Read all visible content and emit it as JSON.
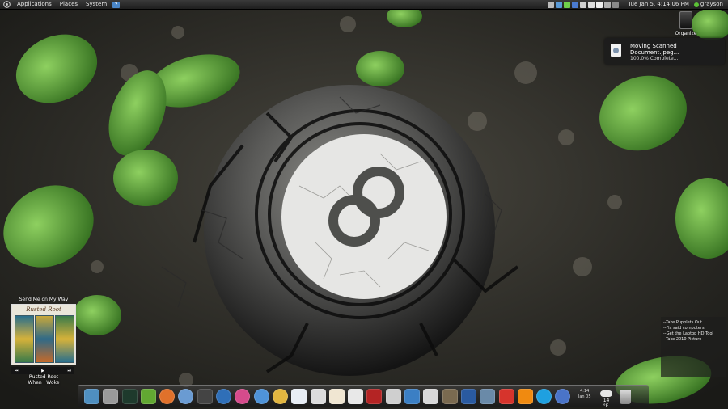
{
  "top_panel": {
    "menus": [
      "Applications",
      "Places",
      "System"
    ],
    "clock": "Tue Jan  5,  4:14:06 PM",
    "user": "grayson",
    "tray_icons": [
      "network-icon",
      "update-icon",
      "messenger-icon",
      "bluetooth-icon",
      "wifi-icon",
      "volume-icon",
      "mail-icon",
      "battery-icon",
      "power-icon"
    ]
  },
  "desktop": {
    "icon_label": "Organize"
  },
  "notification": {
    "title": "Moving Scanned Document.jpeg...",
    "body": "100.0% Complete..."
  },
  "music": {
    "song": "Send Me on My Way",
    "album_logo": "Rusted Root",
    "artist": "Rusted Root",
    "album": "When I Woke",
    "controls": [
      "⏮",
      "▶",
      "⏭"
    ]
  },
  "todo": {
    "items": [
      "--Take Pupplets Out",
      "--Fix said computers",
      "--Get the Laptop HD Tool",
      "--Take 2010 Picture"
    ]
  },
  "dock": {
    "clock_time": "4:14",
    "clock_date": "Jan 05",
    "weather_temp": "14 °F",
    "apps": [
      {
        "name": "home-folder",
        "color": "#4f8fc0"
      },
      {
        "name": "gnome-do",
        "color": "#9a9a9a"
      },
      {
        "name": "system-monitor",
        "color": "#1e3a2c"
      },
      {
        "name": "terminal",
        "color": "#62a832"
      },
      {
        "name": "firefox",
        "color": "#e0712b"
      },
      {
        "name": "thunderbird",
        "color": "#6a9bd2"
      },
      {
        "name": "pidgin",
        "color": "#444444"
      },
      {
        "name": "google-earth",
        "color": "#2f6fb8"
      },
      {
        "name": "picasa",
        "color": "#d64b8c"
      },
      {
        "name": "chromium",
        "color": "#4f93d8"
      },
      {
        "name": "google-chrome",
        "color": "#e2b640"
      },
      {
        "name": "writer",
        "color": "#e8eef5"
      },
      {
        "name": "text-editor",
        "color": "#dcdcdc"
      },
      {
        "name": "impress",
        "color": "#f0e6d2"
      },
      {
        "name": "calc",
        "color": "#e8e8e8"
      },
      {
        "name": "acrobat",
        "color": "#b42424"
      },
      {
        "name": "image-viewer",
        "color": "#cfcfcf"
      },
      {
        "name": "scanner",
        "color": "#3b7fc4"
      },
      {
        "name": "inkscape",
        "color": "#d8d8d8"
      },
      {
        "name": "gimp",
        "color": "#7a6a50"
      },
      {
        "name": "keyboard",
        "color": "#2a5aa0"
      },
      {
        "name": "vmware",
        "color": "#6a8aa8"
      },
      {
        "name": "miro",
        "color": "#d6342c"
      },
      {
        "name": "vlc",
        "color": "#f08a10"
      },
      {
        "name": "skype",
        "color": "#1fa0e0"
      },
      {
        "name": "empathy",
        "color": "#4a74c8"
      }
    ]
  }
}
